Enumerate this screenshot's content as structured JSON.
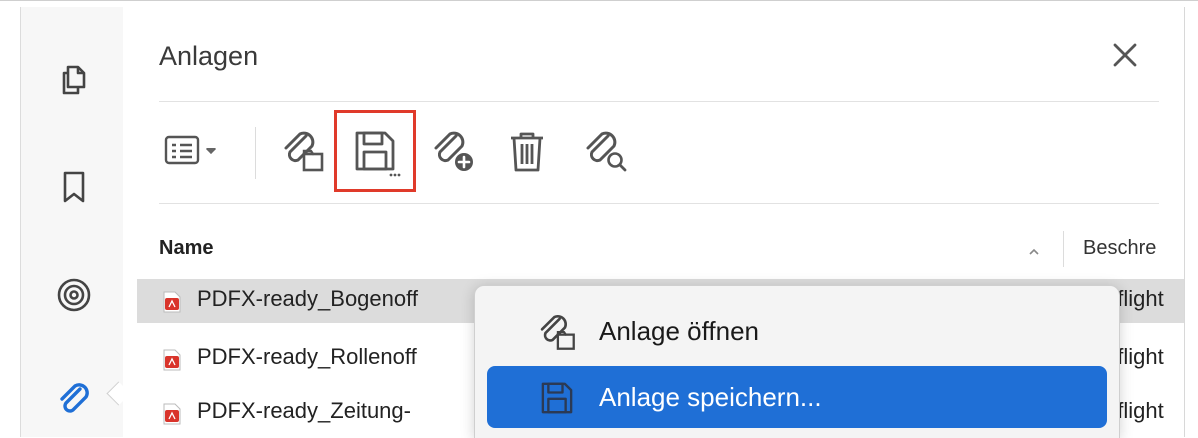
{
  "panel": {
    "title": "Anlagen",
    "close_icon": "close-icon"
  },
  "rail": {
    "items": [
      {
        "name": "pages-icon"
      },
      {
        "name": "bookmark-icon"
      },
      {
        "name": "layers-icon"
      },
      {
        "name": "attachments-icon",
        "active": true
      }
    ]
  },
  "toolbar": {
    "items": [
      {
        "name": "view-options-icon"
      },
      {
        "name": "open-attachment-icon"
      },
      {
        "name": "save-attachment-icon",
        "highlighted": true
      },
      {
        "name": "add-attachment-icon"
      },
      {
        "name": "delete-icon"
      },
      {
        "name": "search-attachment-icon"
      }
    ]
  },
  "table": {
    "columns": [
      "Name",
      "Beschre"
    ],
    "rows": [
      {
        "name": "PDFX-ready_Bogenoff",
        "description": "eflight",
        "selected": true
      },
      {
        "name": "PDFX-ready_Rollenoff",
        "description": "eflight",
        "selected": false
      },
      {
        "name": "PDFX-ready_Zeitung-",
        "description": "eflight",
        "selected": false
      }
    ]
  },
  "context_menu": {
    "items": [
      {
        "label": "Anlage öffnen",
        "icon": "open-attachment-icon",
        "active": false
      },
      {
        "label": "Anlage speichern...",
        "icon": "save-icon",
        "active": true
      }
    ]
  },
  "colors": {
    "highlight_box": "#e03a2a",
    "menu_active": "#1f6fd6",
    "selected_row": "#dcdcdc",
    "attachment_accent": "#1f6fd6",
    "pdf_icon": "#d9342b"
  }
}
